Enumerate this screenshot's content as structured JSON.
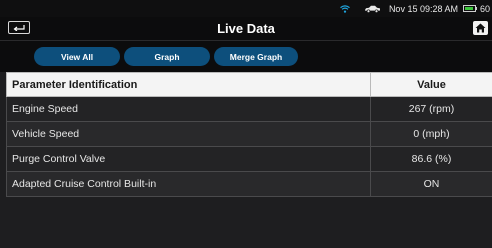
{
  "status_bar": {
    "datetime": "Nov 15 09:28 AM",
    "battery_label": "60",
    "battery_level": 0.85,
    "wifi_color": "#1fa6e0"
  },
  "header": {
    "title": "Live Data",
    "back_icon": "back-arrow-icon",
    "home_icon": "home-icon"
  },
  "tabs": [
    {
      "label": "View All"
    },
    {
      "label": "Graph"
    },
    {
      "label": "Merge Graph"
    }
  ],
  "table": {
    "columns": [
      "Parameter Identification",
      "Value"
    ],
    "rows": [
      {
        "param": "Engine Speed",
        "value": "267 (rpm)"
      },
      {
        "param": "Vehicle Speed",
        "value": "0 (mph)"
      },
      {
        "param": "Purge Control Valve",
        "value": "86.6 (%)"
      },
      {
        "param": "Adapted Cruise Control Built-in",
        "value": "ON"
      }
    ]
  },
  "colors": {
    "accent": "#0d4f7c",
    "background": "#1e1e20",
    "header_row": "#f4f4f4"
  }
}
